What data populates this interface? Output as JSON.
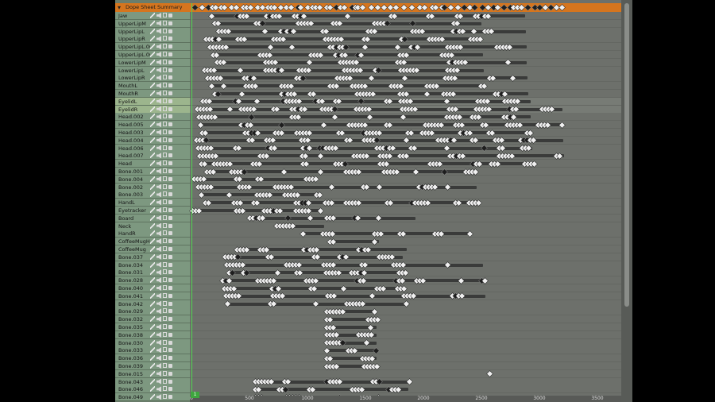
{
  "summary": {
    "label": "Dope Sheet Summary",
    "icon": "action-icon"
  },
  "current_frame": "1",
  "ruler_ticks": [
    "0",
    "500",
    "1000",
    "1500",
    "2000",
    "2500",
    "3000",
    "3500"
  ],
  "colors": {
    "summary": "#d5751e",
    "playhead": "#4fd64f",
    "channel_bg": "#7d9880",
    "channel_selected": "#9cb58d"
  },
  "selected_channels": [
    "EyelidL",
    "EyelidR"
  ],
  "channels": [
    {
      "name": "Jaw"
    },
    {
      "name": "UpperLipM"
    },
    {
      "name": "UpperLipL"
    },
    {
      "name": "UpperLipR"
    },
    {
      "name": "UpperLipL.001"
    },
    {
      "name": "UpperLipL.002"
    },
    {
      "name": "LowerLipM"
    },
    {
      "name": "LowerLipL"
    },
    {
      "name": "LowerLipR"
    },
    {
      "name": "MouthL"
    },
    {
      "name": "MouthR"
    },
    {
      "name": "EyelidL"
    },
    {
      "name": "EyelidR"
    },
    {
      "name": "Head.002"
    },
    {
      "name": "Head.005"
    },
    {
      "name": "Head.003"
    },
    {
      "name": "Head.004"
    },
    {
      "name": "Head.006"
    },
    {
      "name": "Head.007"
    },
    {
      "name": "Head"
    },
    {
      "name": "Bone.001"
    },
    {
      "name": "Bone.004"
    },
    {
      "name": "Bone.002"
    },
    {
      "name": "Bone.003"
    },
    {
      "name": "HandL"
    },
    {
      "name": "Eyetracker"
    },
    {
      "name": "Board"
    },
    {
      "name": "Neck"
    },
    {
      "name": "HandR"
    },
    {
      "name": "CoffeeMugHan"
    },
    {
      "name": "CoffeeMug"
    },
    {
      "name": "Bone.037"
    },
    {
      "name": "Bone.034"
    },
    {
      "name": "Bone.031"
    },
    {
      "name": "Bone.028"
    },
    {
      "name": "Bone.040"
    },
    {
      "name": "Bone.041"
    },
    {
      "name": "Bone.042"
    },
    {
      "name": "Bone.029"
    },
    {
      "name": "Bone.032"
    },
    {
      "name": "Bone.035"
    },
    {
      "name": "Bone.038"
    },
    {
      "name": "Bone.030"
    },
    {
      "name": "Bone.033"
    },
    {
      "name": "Bone.036"
    },
    {
      "name": "Bone.039"
    },
    {
      "name": "Bone.015"
    },
    {
      "name": "Bone.043"
    },
    {
      "name": "Bone.046"
    },
    {
      "name": "Bone.049"
    }
  ]
}
